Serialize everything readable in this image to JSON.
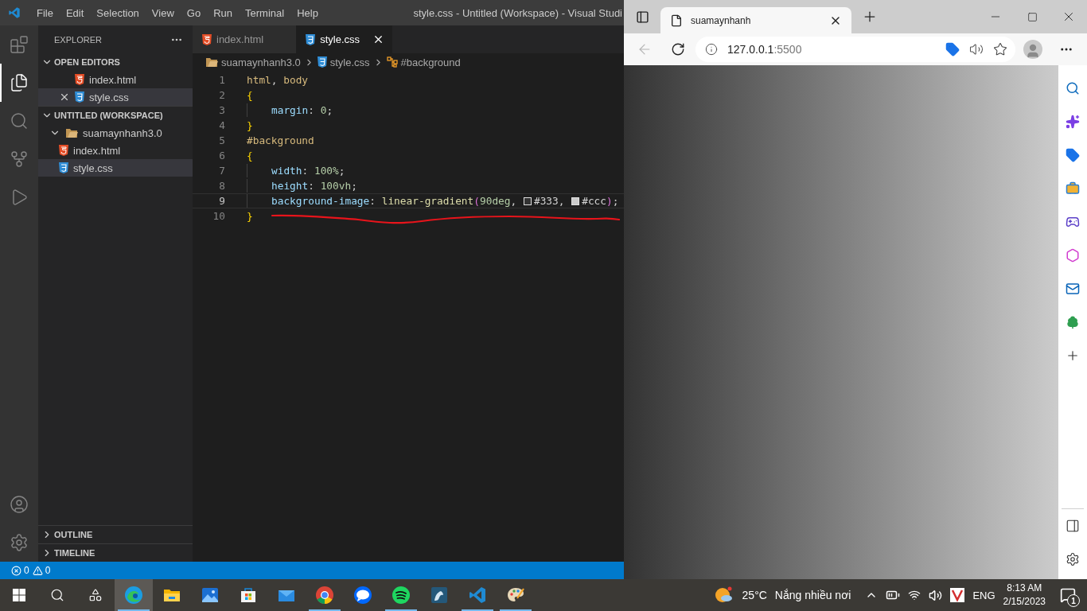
{
  "vscode": {
    "menu": [
      "File",
      "Edit",
      "Selection",
      "View",
      "Go",
      "Run",
      "Terminal",
      "Help"
    ],
    "title": "style.css - Untitled (Workspace) - Visual Studi",
    "activity_bar": [
      {
        "kind": "extensions",
        "selected": false
      },
      {
        "kind": "explorer",
        "selected": true
      },
      {
        "kind": "search",
        "selected": false
      },
      {
        "kind": "source-control",
        "selected": false
      },
      {
        "kind": "run-debug",
        "selected": false
      }
    ],
    "activity_bar_bottom": [
      {
        "kind": "accounts"
      },
      {
        "kind": "settings"
      }
    ],
    "explorer": {
      "title": "EXPLORER",
      "sections": [
        {
          "label": "OPEN EDITORS",
          "expanded": true,
          "items": [
            {
              "name": "index.html",
              "kind": "html",
              "selected": false
            },
            {
              "name": "style.css",
              "kind": "css",
              "selected": true
            }
          ]
        },
        {
          "label": "UNTITLED (WORKSPACE)",
          "expanded": true,
          "items": [
            {
              "name": "suamaynhanh3.0",
              "kind": "folder",
              "expanded": true,
              "selected": false,
              "children": [
                {
                  "name": "index.html",
                  "kind": "html",
                  "selected": false
                },
                {
                  "name": "style.css",
                  "kind": "css",
                  "selected": true
                }
              ]
            }
          ]
        },
        {
          "label": "OUTLINE",
          "expanded": false
        },
        {
          "label": "TIMELINE",
          "expanded": false
        }
      ]
    },
    "tabs": [
      {
        "name": "index.html",
        "kind": "html",
        "selected": false
      },
      {
        "name": "style.css",
        "kind": "css",
        "selected": true
      }
    ],
    "breadcrumbs": [
      {
        "text": "suamaynhanh3.0",
        "kind": "folder"
      },
      {
        "text": "style.css",
        "kind": "css"
      },
      {
        "text": "#background",
        "kind": "symbol"
      }
    ],
    "code": [
      {
        "number": "1",
        "current": false,
        "indent": false,
        "tokens": [
          {
            "text": "html",
            "kind": "selector"
          },
          {
            "text": ", ",
            "kind": "punct"
          },
          {
            "text": "body",
            "kind": "selector"
          }
        ]
      },
      {
        "number": "2",
        "current": false,
        "indent": false,
        "tokens": [
          {
            "text": "{",
            "kind": "brace"
          }
        ]
      },
      {
        "number": "3",
        "current": false,
        "indent": true,
        "tokens": [
          {
            "text": "margin",
            "kind": "property"
          },
          {
            "text": ": ",
            "kind": "punct"
          },
          {
            "text": "0",
            "kind": "number"
          },
          {
            "text": ";",
            "kind": "punct"
          }
        ]
      },
      {
        "number": "4",
        "current": false,
        "indent": false,
        "tokens": [
          {
            "text": "}",
            "kind": "brace"
          }
        ]
      },
      {
        "number": "5",
        "current": false,
        "indent": false,
        "tokens": [
          {
            "text": "#background",
            "kind": "selector"
          }
        ]
      },
      {
        "number": "6",
        "current": false,
        "indent": false,
        "tokens": [
          {
            "text": "{",
            "kind": "brace"
          }
        ]
      },
      {
        "number": "7",
        "current": false,
        "indent": true,
        "tokens": [
          {
            "text": "width",
            "kind": "property"
          },
          {
            "text": ": ",
            "kind": "punct"
          },
          {
            "text": "100%",
            "kind": "number"
          },
          {
            "text": ";",
            "kind": "punct"
          }
        ]
      },
      {
        "number": "8",
        "current": false,
        "indent": true,
        "tokens": [
          {
            "text": "height",
            "kind": "property"
          },
          {
            "text": ": ",
            "kind": "punct"
          },
          {
            "text": "100vh",
            "kind": "number"
          },
          {
            "text": ";",
            "kind": "punct"
          }
        ]
      },
      {
        "number": "9",
        "current": true,
        "indent": true,
        "tokens": [
          {
            "text": "background-image",
            "kind": "property"
          },
          {
            "text": ": ",
            "kind": "punct"
          },
          {
            "text": "linear-gradient",
            "kind": "function"
          },
          {
            "text": "(",
            "kind": "paren"
          },
          {
            "text": "90deg",
            "kind": "number"
          },
          {
            "text": ", ",
            "kind": "punct"
          },
          {
            "kind": "swatch",
            "color": "#333333"
          },
          {
            "text": "#333",
            "kind": "value"
          },
          {
            "text": ", ",
            "kind": "punct"
          },
          {
            "kind": "swatch",
            "color": "#cccccc"
          },
          {
            "text": "#ccc",
            "kind": "value"
          },
          {
            "text": ")",
            "kind": "paren"
          },
          {
            "text": ";",
            "kind": "punct"
          }
        ]
      },
      {
        "number": "10",
        "current": false,
        "indent": false,
        "tokens": [
          {
            "text": "}",
            "kind": "brace"
          }
        ]
      }
    ],
    "status_bar": {
      "errors": "0",
      "warnings": "0"
    }
  },
  "browser": {
    "tab": {
      "title": "suamaynhanh",
      "selected": true
    },
    "address": {
      "host": "127.0.0.1",
      "port": ":5500"
    },
    "sidebar": [
      {
        "kind": "search"
      },
      {
        "kind": "copilot"
      },
      {
        "kind": "shopping"
      },
      {
        "kind": "tools"
      },
      {
        "kind": "games"
      },
      {
        "kind": "office"
      },
      {
        "kind": "outlook"
      },
      {
        "kind": "tree"
      },
      {
        "kind": "add"
      }
    ],
    "sidebar_bottom": [
      {
        "kind": "split"
      },
      {
        "kind": "settings"
      }
    ]
  },
  "taskbar": {
    "apps": [
      {
        "kind": "edge",
        "selected": true,
        "running": true
      },
      {
        "kind": "explorer",
        "selected": false,
        "running": false
      },
      {
        "kind": "photos",
        "selected": false,
        "running": false
      },
      {
        "kind": "store",
        "selected": false,
        "running": false
      },
      {
        "kind": "mail",
        "selected": false,
        "running": false
      },
      {
        "kind": "chrome",
        "selected": false,
        "running": true
      },
      {
        "kind": "zalo",
        "selected": false,
        "running": false
      },
      {
        "kind": "spotify",
        "selected": false,
        "running": true
      },
      {
        "kind": "mysql",
        "selected": false,
        "running": false
      },
      {
        "kind": "vscode",
        "selected": false,
        "running": true
      },
      {
        "kind": "paint",
        "selected": false,
        "running": true
      }
    ],
    "weather": {
      "temperature": "25°C",
      "condition": "Nắng nhiều nơi"
    },
    "language": "ENG",
    "time": "8:13 AM",
    "date": "2/15/2023",
    "notifications": "1"
  }
}
